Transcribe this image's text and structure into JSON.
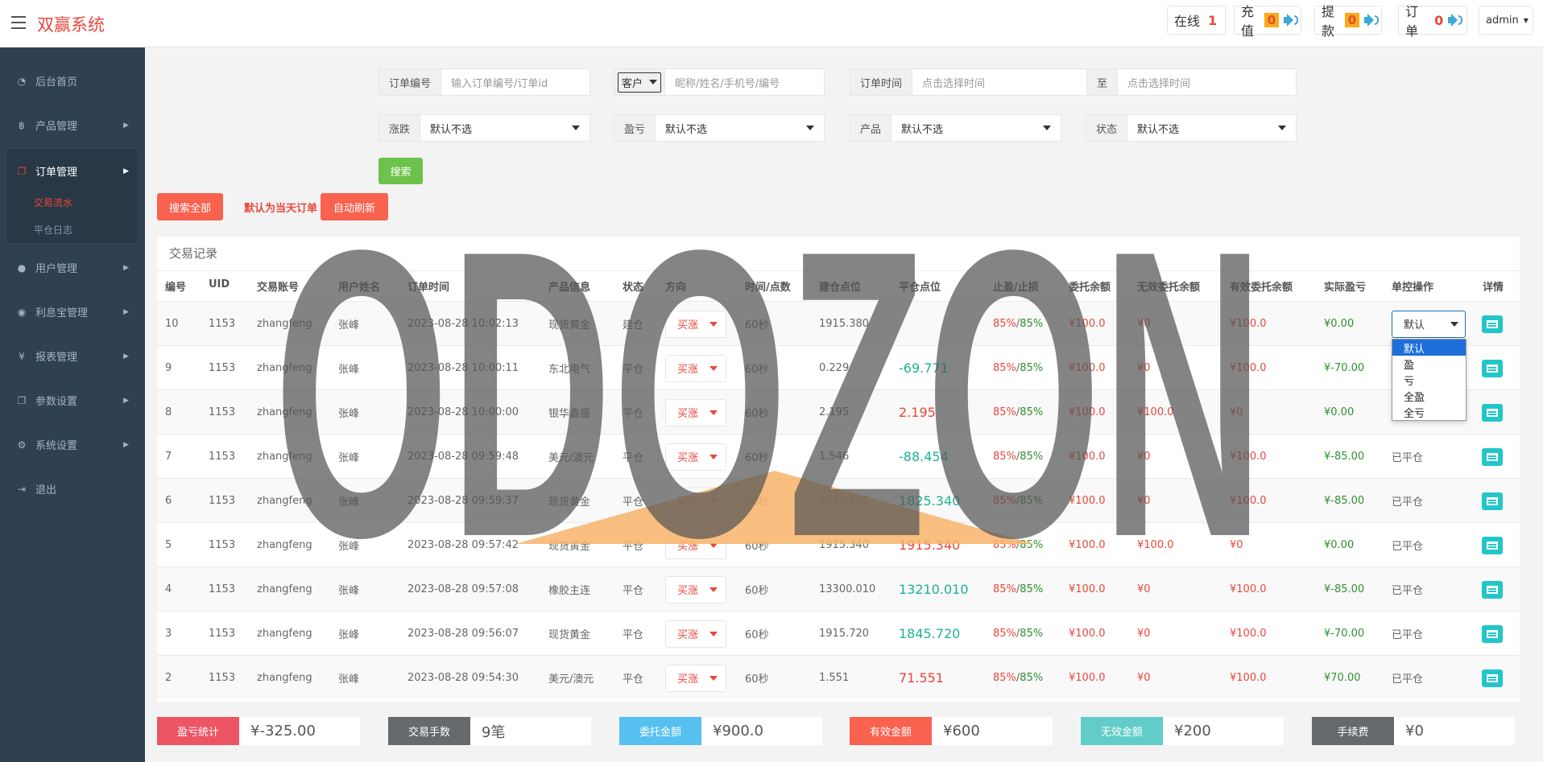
{
  "app": {
    "brand": "双赢系统",
    "user": "admin"
  },
  "topbar": {
    "online_label": "在线",
    "online_count": "1",
    "recharge_label": "充值",
    "recharge_count": "0",
    "withdraw_label": "提款",
    "withdraw_count": "0",
    "order_label": "订单",
    "order_count": "0"
  },
  "sidebar": {
    "items": [
      {
        "label": "后台首页",
        "icon": "dashboard-icon"
      },
      {
        "label": "产品管理",
        "icon": "bitcoin-icon"
      },
      {
        "label": "订单管理",
        "icon": "copy-icon"
      },
      {
        "label": "用户管理",
        "icon": "user-icon"
      },
      {
        "label": "利息宝管理",
        "icon": "coin-icon"
      },
      {
        "label": "报表管理",
        "icon": "yen-icon"
      },
      {
        "label": "参数设置",
        "icon": "copy-icon"
      },
      {
        "label": "系统设置",
        "icon": "gears-icon"
      },
      {
        "label": "退出",
        "icon": "signout-icon"
      }
    ],
    "subitems": [
      "交易流水",
      "平仓日志"
    ]
  },
  "filters": {
    "order_no_label": "订单编号",
    "order_no_placeholder": "输入订单编号/订单id",
    "customer_select": "客户",
    "customer_placeholder": "昵称/姓名/手机号/编号",
    "order_time_label": "订单时间",
    "time_start_placeholder": "点击选择时间",
    "to_label": "至",
    "time_end_placeholder": "点击选择时间",
    "rise_label": "涨跌",
    "rise_value": "默认不选",
    "profit_label": "盈亏",
    "profit_value": "默认不选",
    "product_label": "产品",
    "product_value": "默认不选",
    "status_label": "状态",
    "status_value": "默认不选",
    "search_button": "搜索"
  },
  "actions": {
    "search_all": "搜索全部",
    "default_today": "默认为当天订单",
    "auto_refresh": "自动刷新"
  },
  "table": {
    "title": "交易记录",
    "headers": [
      "编号",
      "UID",
      "交易账号",
      "用户姓名",
      "订单时间",
      "产品信息",
      "状态",
      "方向",
      "时间/点数",
      "建仓点位",
      "平仓点位",
      "止盈/止损",
      "委托余额",
      "无效委托余额",
      "有效委托余额",
      "实际盈亏",
      "单控操作",
      "详情"
    ],
    "rows": [
      {
        "id": "10",
        "uid": "1153",
        "account": "zhangfeng",
        "name": "张峰",
        "time": "2023-08-28 10:02:13",
        "product": "现货黄金",
        "status": "建仓",
        "dir": "买涨",
        "period": "60秒",
        "open": "1915.380",
        "close": "",
        "close_color": "",
        "tp": "85%",
        "sl": "85%",
        "entrust": "¥100.0",
        "invalid": "¥0",
        "valid": "¥100.0",
        "pnl": "¥0.00",
        "control": "默认"
      },
      {
        "id": "9",
        "uid": "1153",
        "account": "zhangfeng",
        "name": "张峰",
        "time": "2023-08-28 10:00:11",
        "product": "东北电气",
        "status": "平仓",
        "dir": "买涨",
        "period": "60秒",
        "open": "0.229",
        "close": "-69.771",
        "close_color": "green",
        "tp": "85%",
        "sl": "85%",
        "entrust": "¥100.0",
        "invalid": "¥0",
        "valid": "¥100.0",
        "pnl": "¥-70.00",
        "control": ""
      },
      {
        "id": "8",
        "uid": "1153",
        "account": "zhangfeng",
        "name": "张峰",
        "time": "2023-08-28 10:00:00",
        "product": "银华鑫盛",
        "status": "平仓",
        "dir": "买涨",
        "period": "60秒",
        "open": "2.195",
        "close": "2.195",
        "close_color": "red",
        "tp": "85%",
        "sl": "85%",
        "entrust": "¥100.0",
        "invalid": "¥100.0",
        "valid": "¥0",
        "pnl": "¥0.00",
        "control": ""
      },
      {
        "id": "7",
        "uid": "1153",
        "account": "zhangfeng",
        "name": "张峰",
        "time": "2023-08-28 09:59:48",
        "product": "美元/澳元",
        "status": "平仓",
        "dir": "买涨",
        "period": "60秒",
        "open": "1.546",
        "close": "-88.454",
        "close_color": "green",
        "tp": "85%",
        "sl": "85%",
        "entrust": "¥100.0",
        "invalid": "¥0",
        "valid": "¥100.0",
        "pnl": "¥-85.00",
        "control": "已平仓"
      },
      {
        "id": "6",
        "uid": "1153",
        "account": "zhangfeng",
        "name": "张峰",
        "time": "2023-08-28 09:59:37",
        "product": "现货黄金",
        "status": "平仓",
        "dir": "买涨",
        "period": "60秒",
        "open": "1915.340",
        "close": "1825.340",
        "close_color": "green",
        "tp": "85%",
        "sl": "85%",
        "entrust": "¥100.0",
        "invalid": "¥0",
        "valid": "¥100.0",
        "pnl": "¥-85.00",
        "control": "已平仓"
      },
      {
        "id": "5",
        "uid": "1153",
        "account": "zhangfeng",
        "name": "张峰",
        "time": "2023-08-28 09:57:42",
        "product": "现货黄金",
        "status": "平仓",
        "dir": "买涨",
        "period": "60秒",
        "open": "1915.340",
        "close": "1915.340",
        "close_color": "red",
        "tp": "85%",
        "sl": "85%",
        "entrust": "¥100.0",
        "invalid": "¥100.0",
        "valid": "¥0",
        "pnl": "¥0.00",
        "control": "已平仓"
      },
      {
        "id": "4",
        "uid": "1153",
        "account": "zhangfeng",
        "name": "张峰",
        "time": "2023-08-28 09:57:08",
        "product": "橡胶主连",
        "status": "平仓",
        "dir": "买涨",
        "period": "60秒",
        "open": "13300.010",
        "close": "13210.010",
        "close_color": "green",
        "tp": "85%",
        "sl": "85%",
        "entrust": "¥100.0",
        "invalid": "¥0",
        "valid": "¥100.0",
        "pnl": "¥-85.00",
        "control": "已平仓"
      },
      {
        "id": "3",
        "uid": "1153",
        "account": "zhangfeng",
        "name": "张峰",
        "time": "2023-08-28 09:56:07",
        "product": "现货黄金",
        "status": "平仓",
        "dir": "买涨",
        "period": "60秒",
        "open": "1915.720",
        "close": "1845.720",
        "close_color": "green",
        "tp": "85%",
        "sl": "85%",
        "entrust": "¥100.0",
        "invalid": "¥0",
        "valid": "¥100.0",
        "pnl": "¥-70.00",
        "control": "已平仓"
      },
      {
        "id": "2",
        "uid": "1153",
        "account": "zhangfeng",
        "name": "张峰",
        "time": "2023-08-28 09:54:30",
        "product": "美元/澳元",
        "status": "平仓",
        "dir": "买涨",
        "period": "60秒",
        "open": "1.551",
        "close": "71.551",
        "close_color": "red",
        "tp": "85%",
        "sl": "85%",
        "entrust": "¥100.0",
        "invalid": "¥0",
        "valid": "¥100.0",
        "pnl": "¥70.00",
        "control": "已平仓"
      }
    ],
    "control_options": [
      "默认",
      "盈",
      "亏",
      "全盈",
      "全亏"
    ]
  },
  "stats": [
    {
      "label": "盈亏统计",
      "value": "¥-325.00",
      "color": "#ed5565"
    },
    {
      "label": "交易手数",
      "value": "9笔",
      "color": "#676a6c"
    },
    {
      "label": "委托金额",
      "value": "¥900.0",
      "color": "#56c1f1"
    },
    {
      "label": "有效金额",
      "value": "¥600",
      "color": "#f8624f"
    },
    {
      "label": "无效金额",
      "value": "¥200",
      "color": "#62cdc8"
    },
    {
      "label": "手续费",
      "value": "¥0",
      "color": "#676a6c"
    }
  ],
  "watermark": {
    "text": "ODOZON",
    "triangle_color": "#f8b46a"
  }
}
